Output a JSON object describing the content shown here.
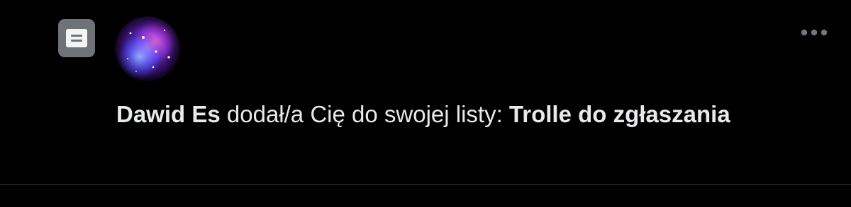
{
  "notification": {
    "icon": "list-icon",
    "avatar_icon": "galaxy-avatar",
    "more_icon": "more-horizontal-icon",
    "actor_name": "Dawid Es",
    "action_text": " dodał/a Cię do swojej listy: ",
    "list_name": "Trolle do zgłaszania"
  },
  "colors": {
    "background": "#000000",
    "text": "#e7e9ea",
    "icon_tile": "#6f7378",
    "more_dots": "#71767b",
    "divider": "#2f3336"
  }
}
